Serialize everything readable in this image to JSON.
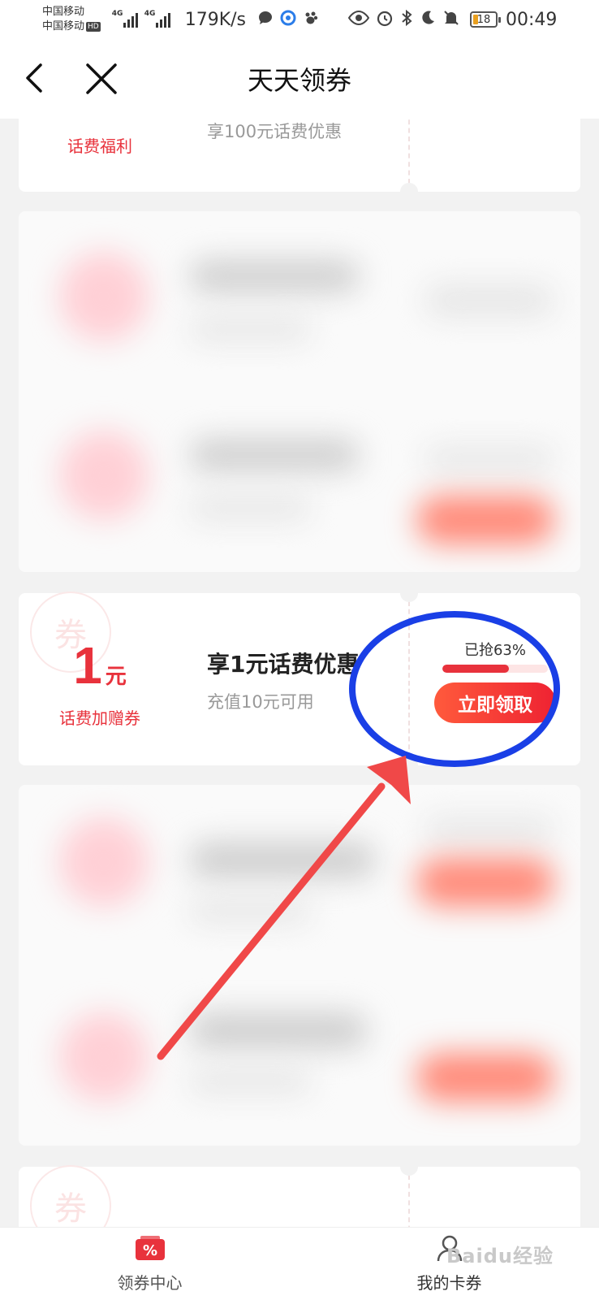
{
  "status_bar": {
    "carrier1": "中国移动",
    "carrier2": "中国移动",
    "hd_badge": "HD",
    "net1": "4G",
    "net2": "4G",
    "speed": "179K/s",
    "battery": "18",
    "time": "00:49"
  },
  "nav": {
    "title": "天天领券"
  },
  "coupons": [
    {
      "tag": "话费福利",
      "subtitle": "享100元话费优惠"
    },
    {
      "amount": "1",
      "unit": "元",
      "tag": "话费加赠券",
      "headline": "享1元话费优惠",
      "condition": "充值10元可用",
      "grabbed_label": "已抢63%",
      "progress": 0.63,
      "button": "立即领取",
      "watermark": "券"
    }
  ],
  "bottom_card": {
    "watermark": "券"
  },
  "tabs": [
    {
      "label": "领券中心",
      "icon": "coupon-icon"
    },
    {
      "label": "我的卡券",
      "icon": "user-icon"
    }
  ],
  "watermark_text": "Baidu经验",
  "colors": {
    "accent_red": "#e8323c",
    "annotation_blue": "#1a3fe6",
    "annotation_arrow": "#f04848"
  }
}
